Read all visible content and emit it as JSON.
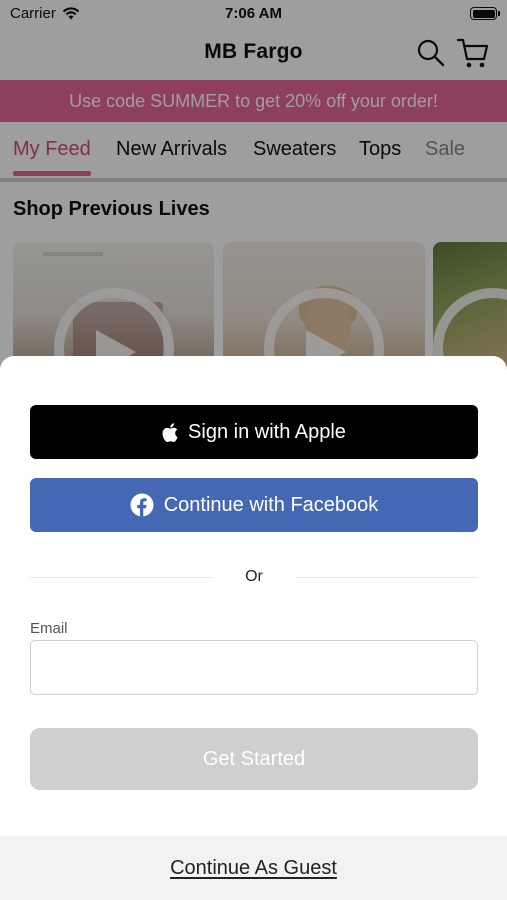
{
  "status_bar": {
    "carrier": "Carrier",
    "time": "7:06 AM"
  },
  "nav": {
    "title": "MB Fargo",
    "search_icon": "search-icon",
    "cart_icon": "cart-icon"
  },
  "promo": {
    "text": "Use code SUMMER to get 20% off your order!",
    "color": "#e66797"
  },
  "tabs": [
    {
      "label": "My Feed",
      "active": true
    },
    {
      "label": "New Arrivals"
    },
    {
      "label": "Sweaters"
    },
    {
      "label": "Tops"
    },
    {
      "label": "Sale"
    }
  ],
  "section": {
    "title": "Shop Previous Lives"
  },
  "sheet": {
    "apple_button": "Sign in with Apple",
    "facebook_button": "Continue with Facebook",
    "or_text": "Or",
    "email_label": "Email",
    "email_value": "",
    "get_started_button": "Get Started",
    "guest_link": "Continue As Guest",
    "colors": {
      "apple": "#000000",
      "facebook": "#4468b3",
      "disabled": "#cfcfcf"
    }
  }
}
